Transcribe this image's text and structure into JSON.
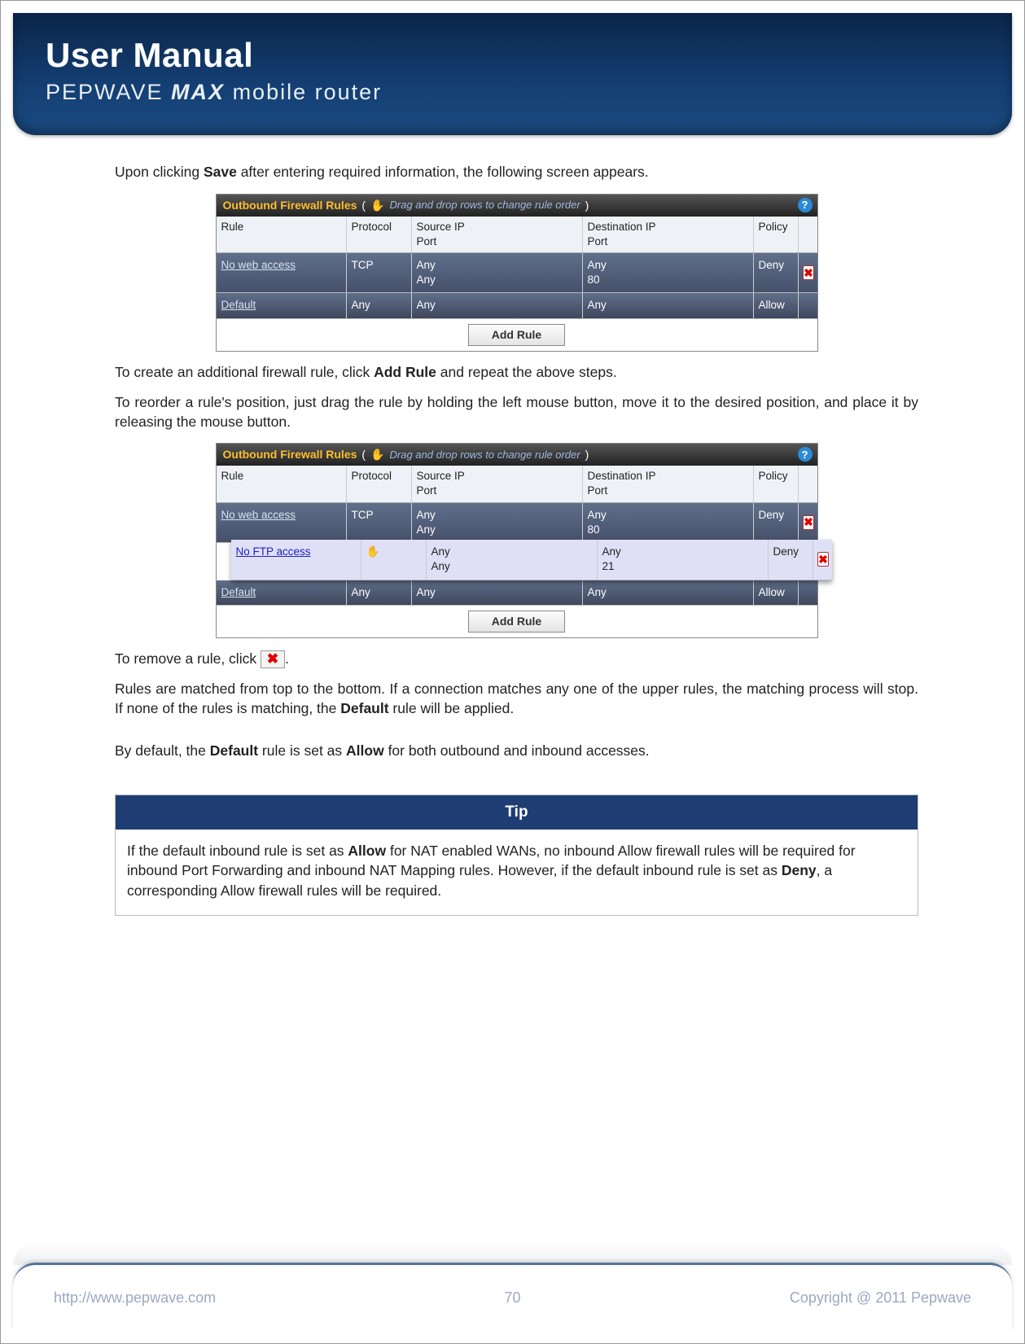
{
  "header": {
    "title": "User Manual",
    "brand": "PEPWAVE",
    "model": "MAX",
    "tail": "mobile router"
  },
  "body": {
    "p1a": "Upon clicking ",
    "p1b": "Save",
    "p1c": " after entering required information, the following screen appears.",
    "p2a": "To create an additional firewall rule, click ",
    "p2b": "Add Rule",
    "p2c": " and repeat the above steps.",
    "p3": "To reorder a rule's position, just drag the rule by holding the left mouse button, move it to the desired position, and place it by releasing the mouse button.",
    "p4a": "To remove a rule, click ",
    "p4b": ".",
    "p5a": "Rules are matched from top to the bottom.  If a connection matches any one of the upper rules, the matching process will stop.  If none of the rules is matching, the ",
    "p5b": "Default",
    "p5c": " rule will be applied.",
    "p6a": "By default, the ",
    "p6b": "Default",
    "p6c": " rule is set as ",
    "p6d": "Allow",
    "p6e": " for both outbound and inbound accesses."
  },
  "fw": {
    "title": "Outbound Firewall Rules",
    "hint": "Drag and drop rows to change rule order",
    "hand": "✋",
    "headers": {
      "rule": "Rule",
      "protocol": "Protocol",
      "srcip": "Source IP",
      "srcport": "Port",
      "dstip": "Destination IP",
      "dstport": "Port",
      "policy": "Policy"
    },
    "addBtn": "Add Rule",
    "helpGlyph": "?",
    "xGlyph": "✖"
  },
  "table1": {
    "r1": {
      "rule": "No web access",
      "proto": "TCP",
      "src1": "Any",
      "src2": "Any",
      "dst1": "Any",
      "dst2": "80",
      "policy": "Deny"
    },
    "r2": {
      "rule": "Default",
      "proto": "Any",
      "src": "Any",
      "dst": "Any",
      "policy": "Allow"
    }
  },
  "table2": {
    "r1": {
      "rule": "No web access",
      "proto": "TCP",
      "src1": "Any",
      "src2": "Any",
      "dst1": "Any",
      "dst2": "80",
      "policy": "Deny"
    },
    "r2": {
      "rule": "No FTP access",
      "handGlyph": "✋",
      "src1": "Any",
      "src2": "Any",
      "dst1": "Any",
      "dst2": "21",
      "policy": "Deny"
    },
    "r3": {
      "rule": "Default",
      "proto": "Any",
      "src": "Any",
      "dst": "Any",
      "policy": "Allow"
    }
  },
  "tip": {
    "head": "Tip",
    "b1": "If the default inbound rule is set as ",
    "bold1": "Allow",
    "b2": " for NAT enabled WANs, no inbound Allow firewall rules will be required for inbound Port Forwarding and inbound NAT Mapping rules.  However, if the default inbound rule is set as ",
    "bold2": "Deny",
    "b3": ", a corresponding Allow firewall rules will be required."
  },
  "footer": {
    "url": "http://www.pepwave.com",
    "page": "70",
    "copy": "Copyright @ 2011 Pepwave"
  }
}
